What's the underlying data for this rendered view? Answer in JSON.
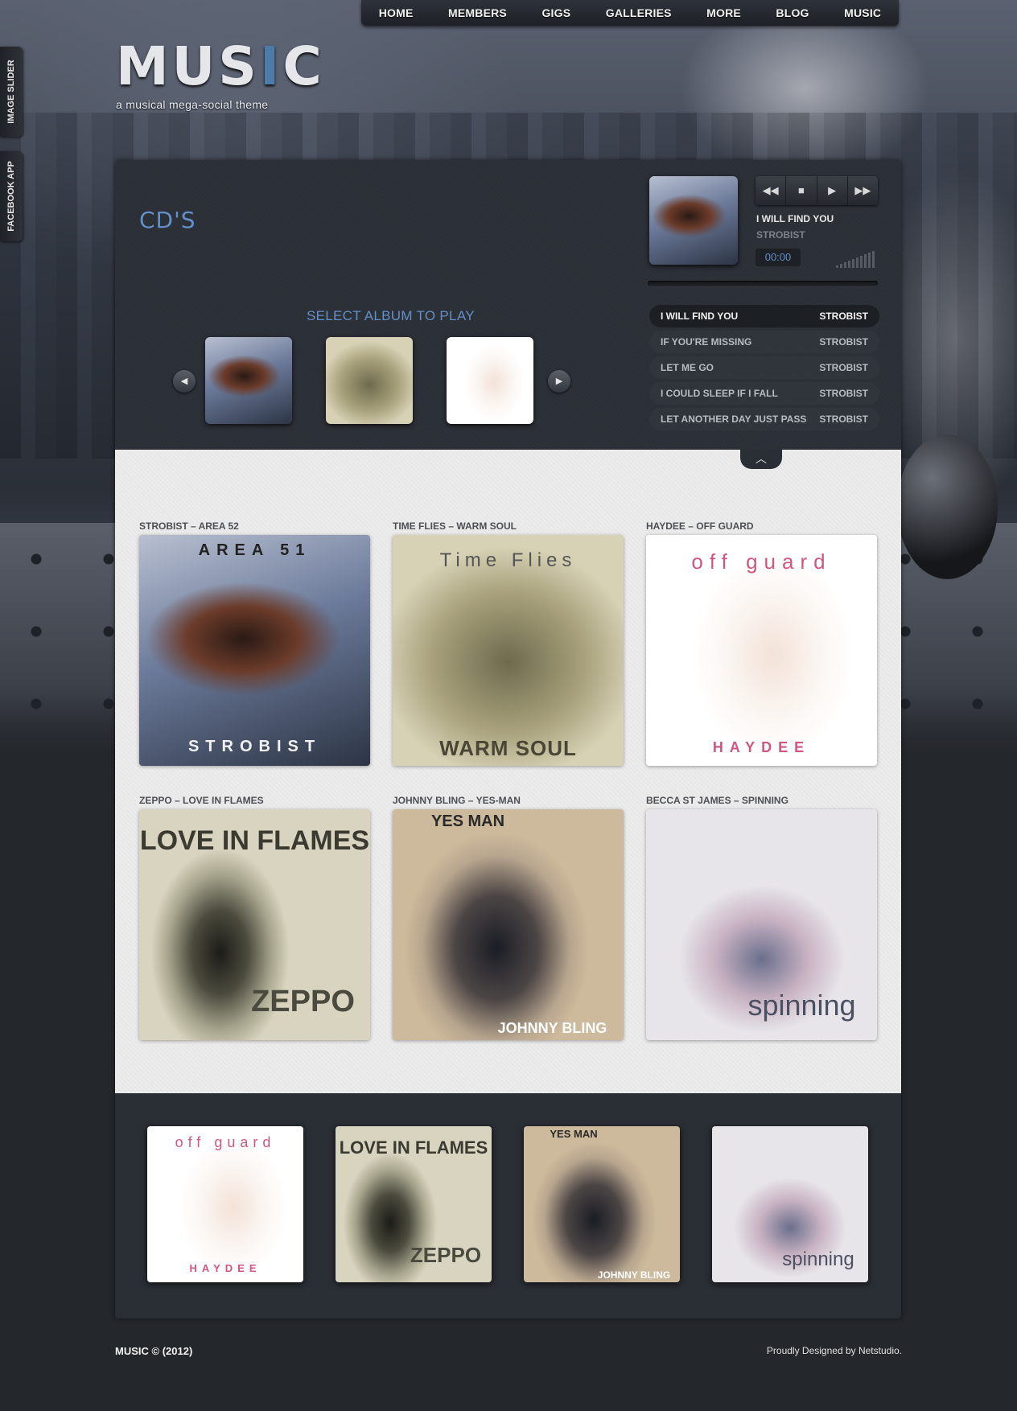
{
  "nav": [
    "HOME",
    "MEMBERS",
    "GIGS",
    "GALLERIES",
    "MORE",
    "BLOG",
    "MUSIC"
  ],
  "side_tabs": {
    "image_slider": "IMAGE SLIDER",
    "facebook_app": "FACEBOOK APP"
  },
  "logo": {
    "text_pre": "MUS",
    "text_hl": "I",
    "text_post": "C",
    "tagline": "a musical mega-social theme"
  },
  "section_title": "CD'S",
  "carousel": {
    "title": "SELECT ALBUM TO PLAY",
    "prev_icon": "chevron-left-icon",
    "next_icon": "chevron-right-icon"
  },
  "player": {
    "controls": [
      "rewind-icon",
      "stop-icon",
      "play-icon",
      "fast-forward-icon"
    ],
    "title": "I WILL FIND YOU",
    "artist": "STROBIST",
    "time": "00:00",
    "progress": 0
  },
  "tracks": [
    {
      "title": "I WILL FIND YOU",
      "artist": "STROBIST",
      "active": true
    },
    {
      "title": "IF YOU'RE MISSING",
      "artist": "STROBIST",
      "active": false
    },
    {
      "title": "LET ME GO",
      "artist": "STROBIST",
      "active": false
    },
    {
      "title": "I COULD SLEEP IF I FALL",
      "artist": "STROBIST",
      "active": false
    },
    {
      "title": "LET ANOTHER DAY JUST PASS",
      "artist": "STROBIST",
      "active": false
    }
  ],
  "albums": [
    {
      "caption": "STROBIST – AREA 52",
      "art_top": "AREA 51",
      "art_bottom": "STROBIST"
    },
    {
      "caption": "TIME FLIES – WARM SOUL",
      "art_top": "Time Flies",
      "art_bottom": "WARM SOUL"
    },
    {
      "caption": "HAYDEE – OFF GUARD",
      "art_top": "off guard",
      "art_bottom": "HAYDEE"
    },
    {
      "caption": "ZEPPO – LOVE IN FLAMES",
      "art_top": "LOVE IN FLAMES",
      "art_bottom": "ZEPPO"
    },
    {
      "caption": "JOHNNY BLING – YES-MAN",
      "art_top": "YES MAN",
      "art_bottom": "JOHNNY BLING"
    },
    {
      "caption": "BECCA ST JAMES – SPINNING",
      "art_top": "",
      "art_bottom": "spinning"
    }
  ],
  "footer": {
    "left": "MUSIC © (2012)",
    "right": "Proudly Designed by Netstudio."
  },
  "colors": {
    "accent": "#6390c6",
    "panel": "#2a2e35",
    "grid_bg": "#ececec"
  }
}
